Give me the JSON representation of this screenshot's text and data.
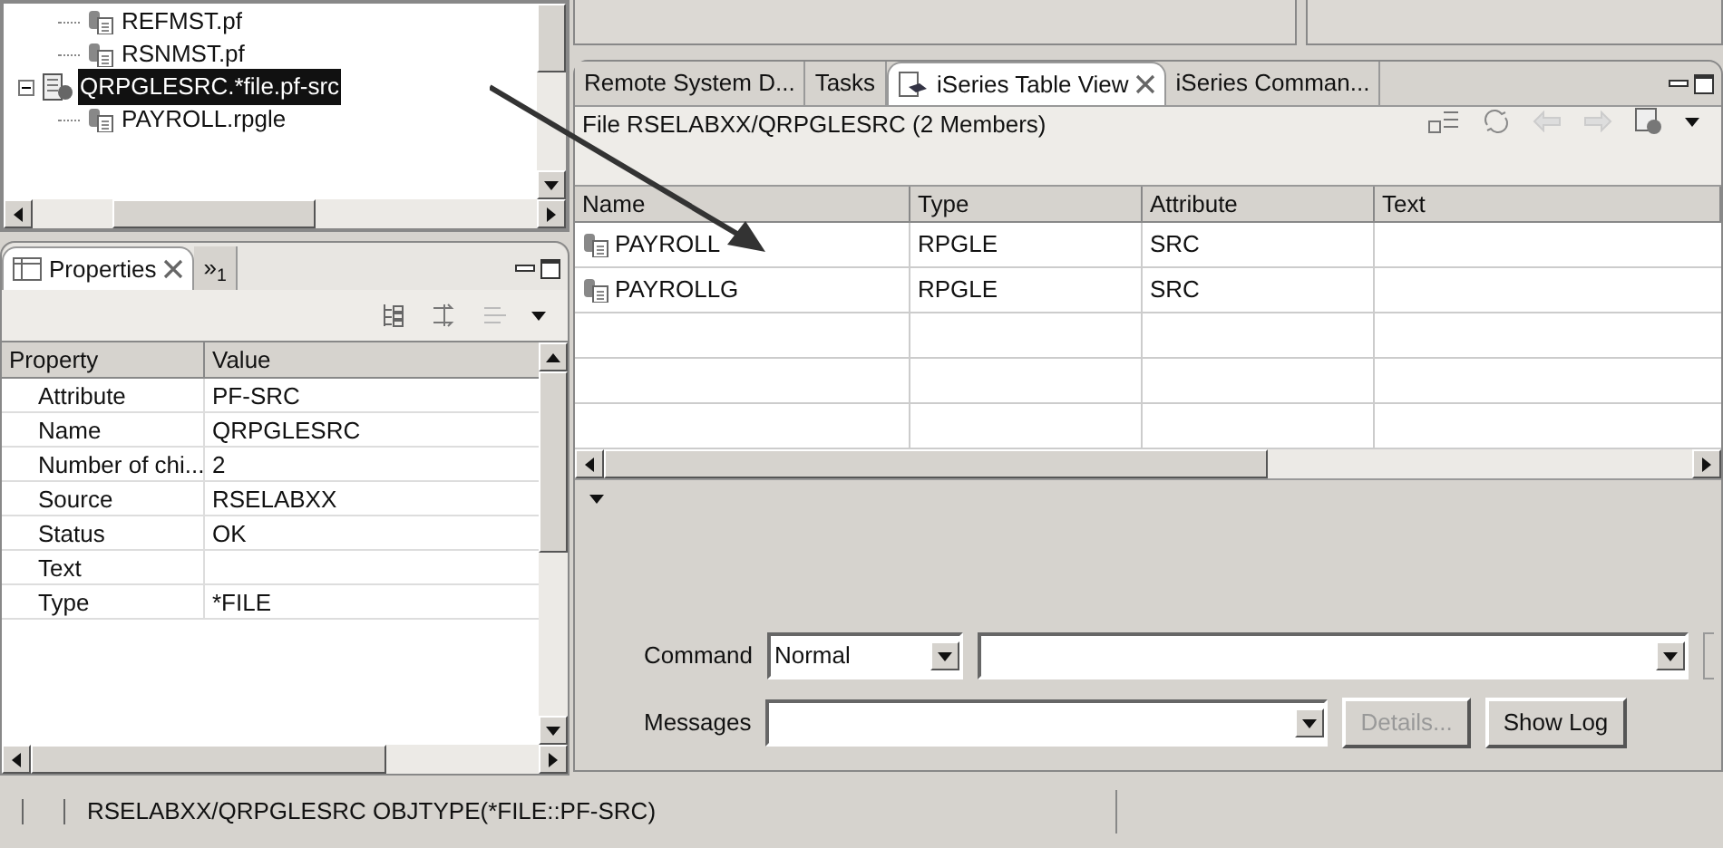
{
  "tree": {
    "items": [
      {
        "label": "REFMST.pf",
        "kind": "member",
        "selected": false
      },
      {
        "label": "RSNMST.pf",
        "kind": "member",
        "selected": false
      },
      {
        "label": "QRPGLESRC.*file.pf-src",
        "kind": "file",
        "selected": true,
        "expanded": true,
        "children": [
          {
            "label": "PAYROLL.rpgle",
            "kind": "member",
            "selected": false
          }
        ]
      }
    ]
  },
  "properties_view": {
    "tabs": [
      {
        "label": "Properties",
        "selected": true,
        "closable": true
      },
      {
        "label": "»$_{1}$",
        "selected": false,
        "closable": false
      }
    ],
    "columns": [
      "Property",
      "Value"
    ],
    "rows": [
      {
        "property": "Attribute",
        "value": "PF-SRC"
      },
      {
        "property": "Name",
        "value": "QRPGLESRC"
      },
      {
        "property": "Number of chi...",
        "value": "2"
      },
      {
        "property": "Source",
        "value": "RSELABXX"
      },
      {
        "property": "Status",
        "value": "OK"
      },
      {
        "property": "Text"
      },
      {
        "property": "Type",
        "value": "*FILE"
      }
    ]
  },
  "main_view": {
    "tabs": [
      {
        "label": "Remote System D...",
        "selected": false,
        "closable": false
      },
      {
        "label": "Tasks",
        "selected": false,
        "closable": false
      },
      {
        "label": "iSeries Table View",
        "selected": true,
        "closable": true
      },
      {
        "label": "iSeries Comman...",
        "selected": false,
        "closable": false
      }
    ],
    "heading": "File RSELABXX/QRPGLESRC (2 Members)",
    "columns": [
      "Name",
      "Type",
      "Attribute",
      "Text"
    ],
    "rows": [
      {
        "name": "PAYROLL",
        "type": "RPGLE",
        "attribute": "SRC"
      },
      {
        "name": "PAYROLLG",
        "type": "RPGLE",
        "attribute": "SRC"
      }
    ],
    "command": {
      "label": "Command",
      "mode": "Normal"
    },
    "messages": {
      "label": "Messages",
      "buttons": [
        {
          "label": "Details...",
          "disabled": true
        },
        {
          "label": "Show Log",
          "disabled": false
        }
      ]
    }
  },
  "status_bar": {
    "text": "RSELABXX/QRPGLESRC OBJTYPE(*FILE::PF-SRC)"
  }
}
